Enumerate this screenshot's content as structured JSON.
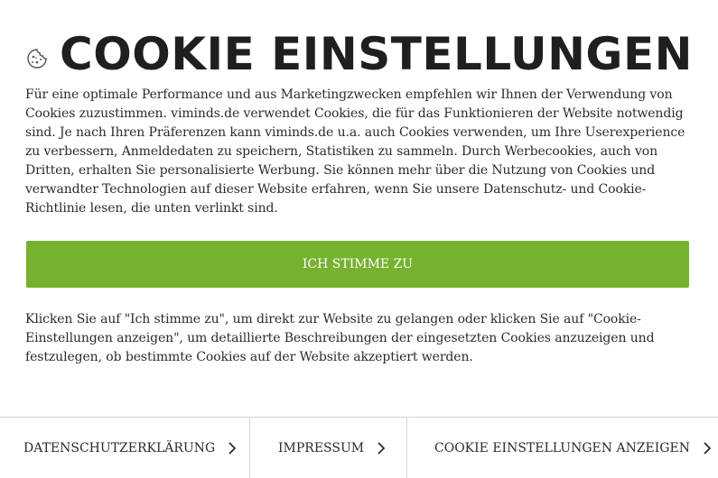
{
  "banner": {
    "title": "COOKIE EINSTELLUNGEN",
    "intro": "Für eine optimale Performance und aus Marketingzwecken empfehlen wir Ihnen der Verwendung von Cookies zuzustimmen. viminds.de verwendet Cookies, die für das Funktionieren der Website notwendig sind. Je nach Ihren Präferenzen kann viminds.de u.a. auch Cookies verwenden, um Ihre Userexperience zu verbessern, Anmeldedaten zu speichern, Statistiken zu sammeln. Durch Werbecookies, auch von Dritten, erhalten Sie personalisierte Werbung. Sie können mehr über die Nutzung von Cookies und verwandter Technologien auf dieser Website erfahren, wenn Sie unsere Datenschutz- und Cookie-Richtlinie lesen, die unten verlinkt sind.",
    "accept_label": "ICH STIMME ZU",
    "note": "Klicken Sie auf \"Ich stimme zu\", um direkt zur Website zu gelangen oder klicken Sie auf \"Cookie-Einstellungen anzeigen\", um detaillierte Beschreibungen der eingesetzten Cookies anzuzeigen und festzulegen, ob bestimmte Cookies auf der Website akzeptiert werden."
  },
  "footer": {
    "privacy_label": "DATENSCHUTZERKLÄRUNG",
    "imprint_label": "IMPRESSUM",
    "settings_label": "COOKIE EINSTELLUNGEN ANZEIGEN"
  },
  "colors": {
    "accent": "#76b22f",
    "text": "#2b2b2b"
  },
  "icons": {
    "title_icon": "cookie-icon",
    "link_icon": "chevron-right-icon"
  }
}
